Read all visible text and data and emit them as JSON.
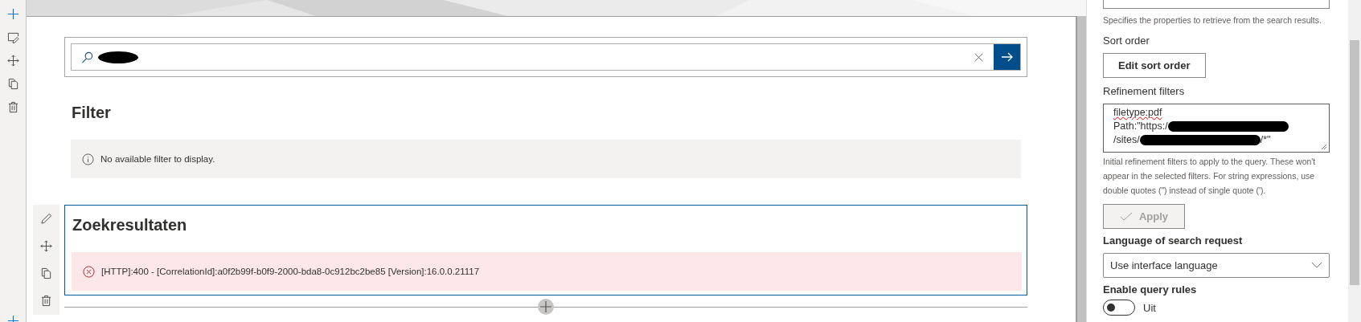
{
  "search_box": {
    "value_parts": [
      {
        "kind": "redaction"
      }
    ]
  },
  "filter_webpart": {
    "title": "Filter",
    "message": "No available filter to display."
  },
  "results_webpart": {
    "selected": true,
    "title": "Zoekresultaten",
    "error": "[HTTP]:400 - [CorrelationId]:a0f2b99f-b0f9-2000-bda8-0c912bc2be85 [Version]:16.0.0.21117"
  },
  "property_pane": {
    "selected_properties": {
      "description": "Specifies the properties to retrieve from the search results."
    },
    "sort_order": {
      "label": "Sort order",
      "button": "Edit sort order"
    },
    "refinement_filters": {
      "label": "Refinement filters",
      "lines": [
        [
          {
            "kind": "text",
            "text": "filetype:pdf",
            "misspelled": true
          }
        ],
        [
          {
            "kind": "text",
            "text": "Path:\"https:/",
            "misspelled": false
          },
          {
            "kind": "redaction"
          }
        ],
        [
          {
            "kind": "text",
            "text": "/sites/",
            "misspelled": false
          },
          {
            "kind": "redaction"
          },
          {
            "kind": "text",
            "text": "/*\"",
            "misspelled": false
          }
        ]
      ],
      "description": "Initial refinement filters to apply to the query. These won't appear in the selected filters. For string expressions, use double quotes (\") instead of single quote (')."
    },
    "apply_button": {
      "label": "Apply",
      "disabled": true
    },
    "language": {
      "label": "Language of search request",
      "value": "Use interface language"
    },
    "query_rules": {
      "label": "Enable query rules",
      "on": false,
      "state_label": "Uit"
    }
  }
}
